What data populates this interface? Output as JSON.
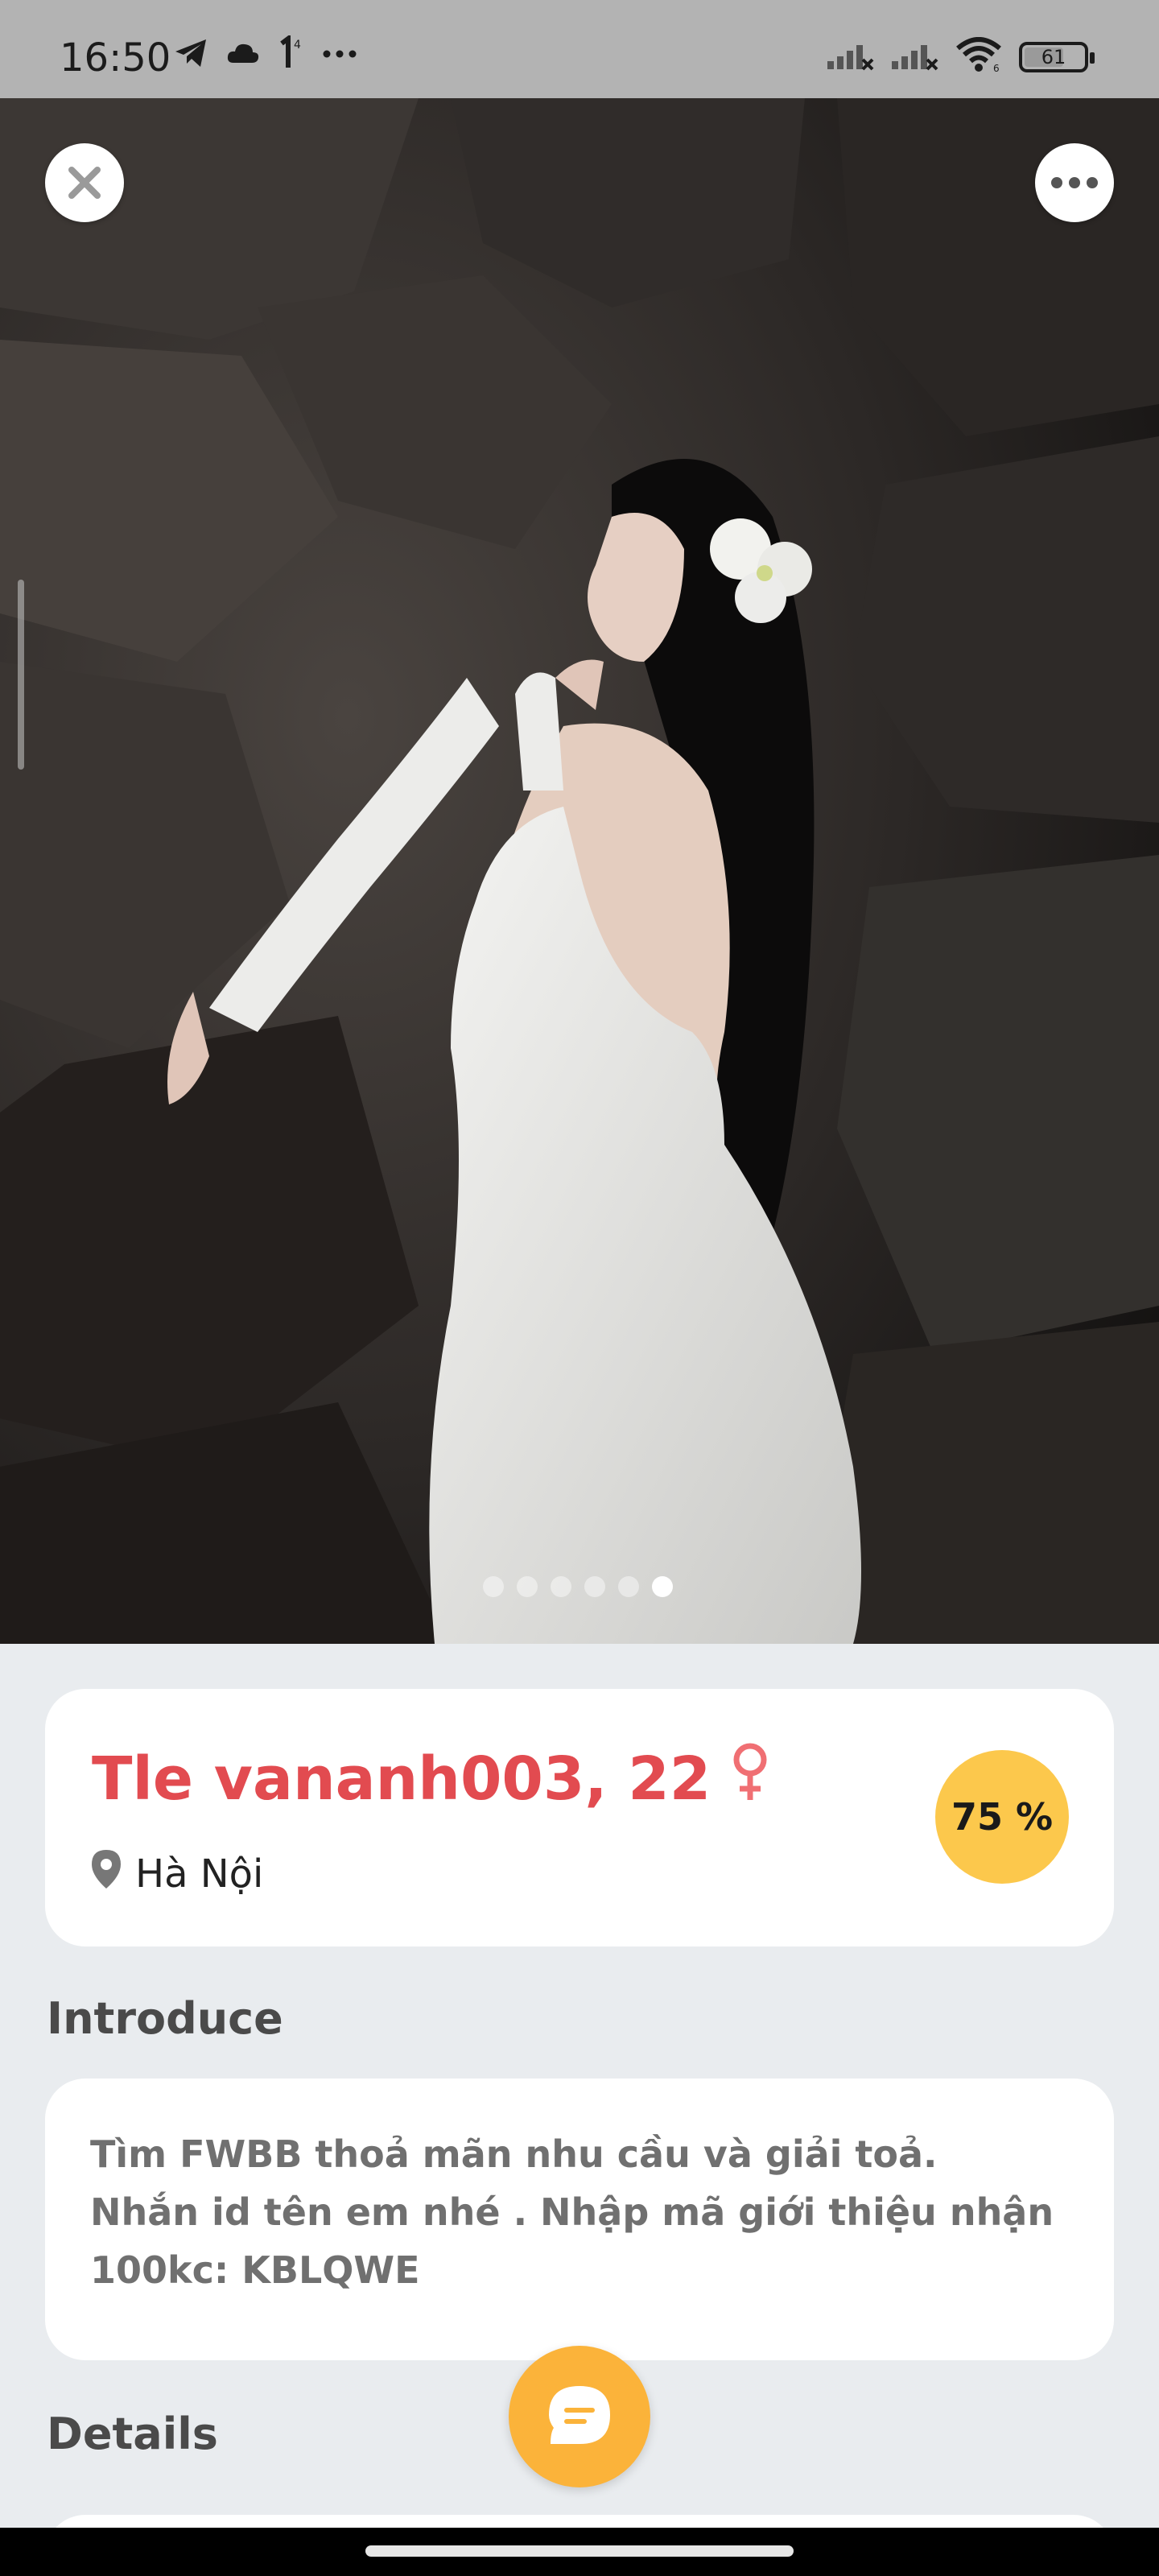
{
  "status_bar": {
    "time": "16:50",
    "icons_left": [
      "telegram-icon",
      "cloud-icon",
      "notification-icon",
      "more-dots-icon"
    ],
    "icons_right": [
      "signal-icon",
      "signal-icon",
      "wifi-icon",
      "battery-icon"
    ],
    "battery_level": "61"
  },
  "photo": {
    "page_count": 6,
    "active_page": 6
  },
  "profile": {
    "name": "Tle vananh003, 22",
    "gender_icon": "female-icon",
    "location": "Hà Nội",
    "match_percent": "75 %"
  },
  "introduce": {
    "title": "Introduce",
    "text": "Tìm FWBB thoả mãn nhu cầu và giải toả. Nhắn id tên em nhé . Nhập mã giới thiệu nhận 100kc: KBLQWE"
  },
  "details": {
    "title": "Details"
  },
  "colors": {
    "name": "#e24b50",
    "match_badge": "#fcc84c",
    "chat_button": "#fbb33a",
    "background": "#e9ecef"
  }
}
